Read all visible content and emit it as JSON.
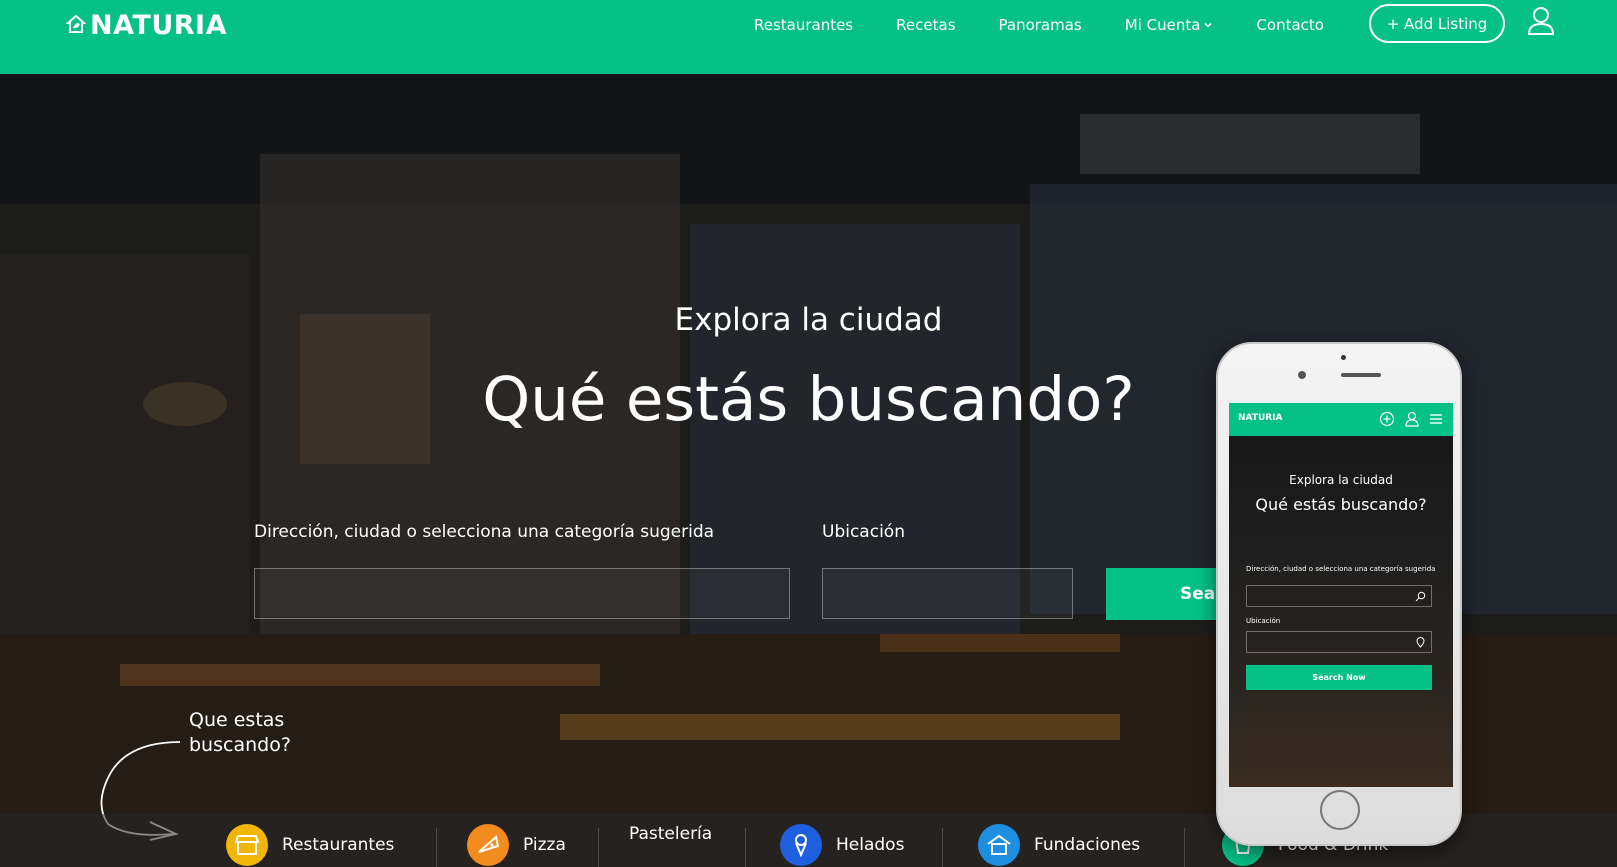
{
  "brand": {
    "name": "NATURIA",
    "color": "#05c186"
  },
  "nav": {
    "items": [
      "Restaurantes",
      "Recetas",
      "Panoramas",
      "Mi Cuenta",
      "Contacto"
    ],
    "add_listing": "+ Add Listing",
    "icons": {
      "account": "user-icon",
      "dropdown": "chevron-down-icon"
    }
  },
  "hero": {
    "subtitle": "Explora la ciudad",
    "title": "Qué estás buscando?",
    "search": {
      "query_label": "Dirección, ciudad o selecciona una categoría sugerida",
      "query_value": "",
      "location_label": "Ubicación",
      "location_value": "",
      "button_label": "Sea"
    },
    "hint": "Que estas buscando?"
  },
  "categories": [
    {
      "label": "Restaurantes",
      "icon": "storefront-icon",
      "color": "#f2b705"
    },
    {
      "label": "Pizza",
      "icon": "pizza-icon",
      "color": "#f28c1e"
    },
    {
      "label": "Pastelería",
      "icon": "cake-icon",
      "color": ""
    },
    {
      "label": "Helados",
      "icon": "ice-cream-icon",
      "color": "#1e5fe0"
    },
    {
      "label": "Fundaciones",
      "icon": "house-icon",
      "color": "#1e8fe0"
    },
    {
      "label": "Food & Drink",
      "icon": "cup-icon",
      "color": "#05c186"
    }
  ],
  "phone": {
    "brand": "NATURIA",
    "subtitle": "Explora la ciudad",
    "title": "Qué estás buscando?",
    "query_label": "Dirección, ciudad o selecciona una categoría sugerida",
    "location_label": "Ubicación",
    "button_label": "Search Now"
  }
}
